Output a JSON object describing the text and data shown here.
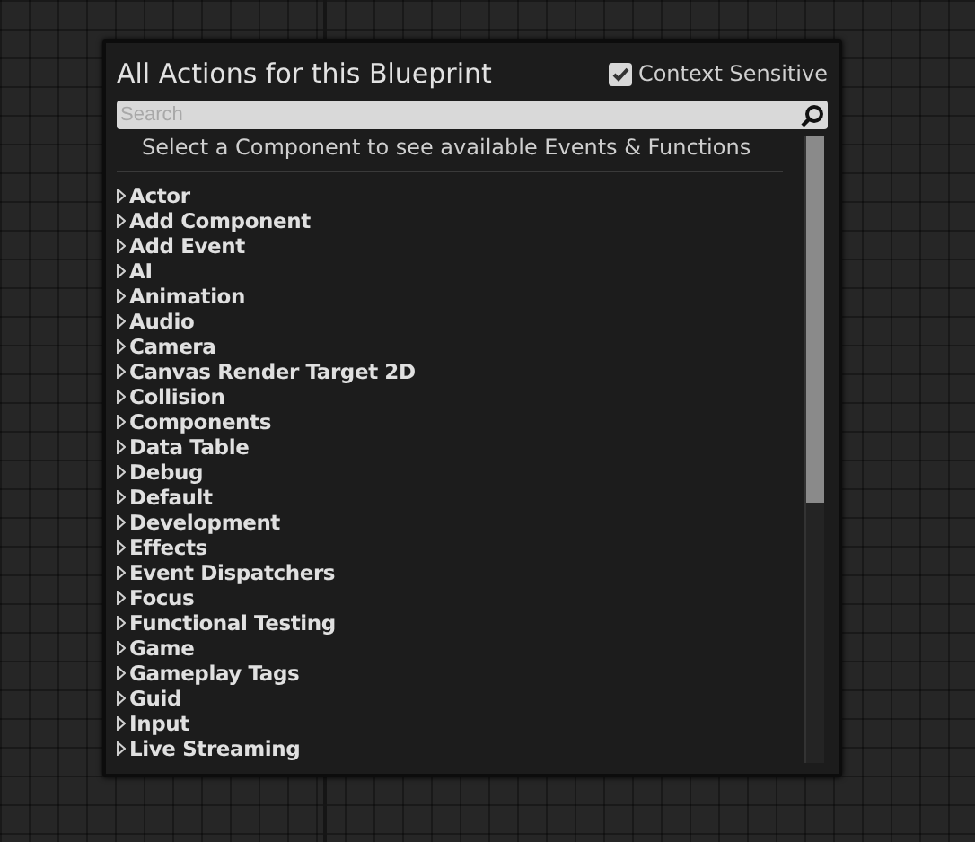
{
  "panel": {
    "title": "All Actions for this Blueprint",
    "context_sensitive": {
      "label": "Context Sensitive",
      "checked": true
    }
  },
  "search": {
    "placeholder": "Search"
  },
  "hint": "Select a Component to see available Events & Functions",
  "categories": [
    {
      "label": "Actor"
    },
    {
      "label": "Add Component"
    },
    {
      "label": "Add Event"
    },
    {
      "label": "AI"
    },
    {
      "label": "Animation"
    },
    {
      "label": "Audio"
    },
    {
      "label": "Camera"
    },
    {
      "label": "Canvas Render Target 2D"
    },
    {
      "label": "Collision"
    },
    {
      "label": "Components"
    },
    {
      "label": "Data Table"
    },
    {
      "label": "Debug"
    },
    {
      "label": "Default"
    },
    {
      "label": "Development"
    },
    {
      "label": "Effects"
    },
    {
      "label": "Event Dispatchers"
    },
    {
      "label": "Focus"
    },
    {
      "label": "Functional Testing"
    },
    {
      "label": "Game"
    },
    {
      "label": "Gameplay Tags"
    },
    {
      "label": "Guid"
    },
    {
      "label": "Input"
    },
    {
      "label": "Live Streaming"
    }
  ]
}
